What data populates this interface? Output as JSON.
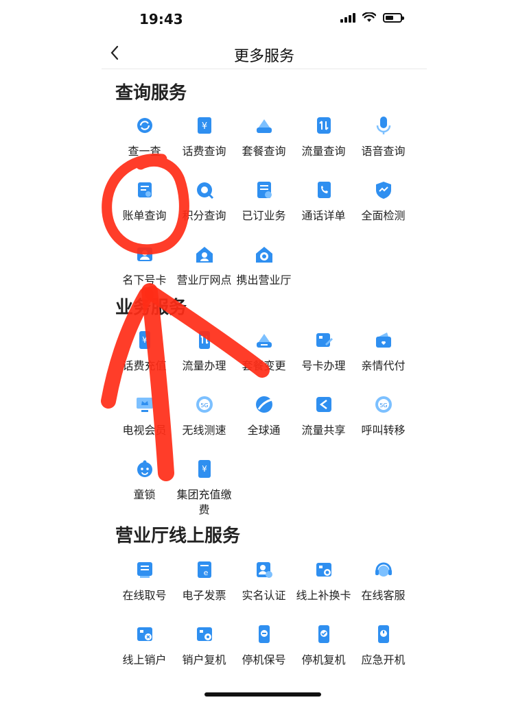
{
  "status_bar": {
    "time": "19:43"
  },
  "nav": {
    "back_icon": "chevron-left-icon",
    "title": "更多服务"
  },
  "sections": [
    {
      "title": "查询服务",
      "items": [
        {
          "label": "查一查",
          "icon": "search-refresh-icon"
        },
        {
          "label": "话费查询",
          "icon": "yuan-doc-icon"
        },
        {
          "label": "套餐查询",
          "icon": "package-icon"
        },
        {
          "label": "流量查询",
          "icon": "data-arrows-icon"
        },
        {
          "label": "语音查询",
          "icon": "microphone-icon"
        },
        {
          "label": "账单查询",
          "icon": "bill-icon"
        },
        {
          "label": "积分查询",
          "icon": "points-icon"
        },
        {
          "label": "已订业务",
          "icon": "subscribed-icon"
        },
        {
          "label": "通话详单",
          "icon": "call-detail-icon"
        },
        {
          "label": "全面检测",
          "icon": "shield-icon"
        },
        {
          "label": "名下号卡",
          "icon": "person-card-icon"
        },
        {
          "label": "营业厅网点",
          "icon": "store-home-icon"
        },
        {
          "label": "携出营业厅",
          "icon": "phone-home-icon"
        }
      ]
    },
    {
      "title": "业务服务",
      "items": [
        {
          "label": "话费充值",
          "icon": "yuan-phone-icon"
        },
        {
          "label": "流量办理",
          "icon": "data-phone-icon"
        },
        {
          "label": "套餐变更",
          "icon": "package-swap-icon"
        },
        {
          "label": "号卡办理",
          "icon": "sim-edit-icon"
        },
        {
          "label": "亲情代付",
          "icon": "wallet-heart-icon"
        },
        {
          "label": "电视会员",
          "icon": "tv-crown-icon"
        },
        {
          "label": "无线测速",
          "icon": "speed-5g-icon"
        },
        {
          "label": "全球通",
          "icon": "global-icon"
        },
        {
          "label": "流量共享",
          "icon": "share-icon"
        },
        {
          "label": "呼叫转移",
          "icon": "call-forward-icon"
        },
        {
          "label": "童锁",
          "icon": "child-face-icon"
        },
        {
          "label": "集团充值缴费",
          "icon": "group-pay-icon"
        }
      ]
    },
    {
      "title": "营业厅线上服务",
      "items": [
        {
          "label": "在线取号",
          "icon": "queue-ticket-icon"
        },
        {
          "label": "电子发票",
          "icon": "e-invoice-icon"
        },
        {
          "label": "实名认证",
          "icon": "id-verify-icon"
        },
        {
          "label": "线上补换卡",
          "icon": "sim-replace-icon"
        },
        {
          "label": "在线客服",
          "icon": "headset-icon"
        },
        {
          "label": "线上销户",
          "icon": "sim-cancel-icon"
        },
        {
          "label": "销户复机",
          "icon": "sim-restore-icon"
        },
        {
          "label": "停机保号",
          "icon": "phone-pause-icon"
        },
        {
          "label": "停机复机",
          "icon": "phone-resume-icon"
        },
        {
          "label": "应急开机",
          "icon": "phone-power-icon"
        }
      ]
    }
  ],
  "colors": {
    "icon_primary": "#2f8ff0",
    "icon_light": "#7cc0ff",
    "annotation": "#ff2d17"
  }
}
